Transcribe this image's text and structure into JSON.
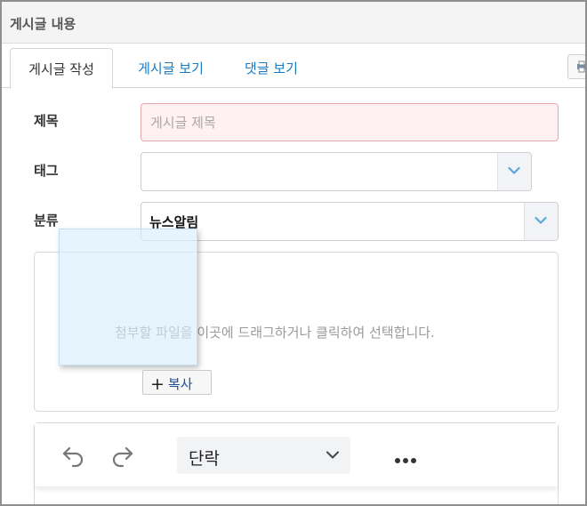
{
  "window": {
    "title": "게시글 내용"
  },
  "tabs": [
    {
      "label": "게시글 작성",
      "active": true
    },
    {
      "label": "게시글 보기",
      "active": false
    },
    {
      "label": "댓글 보기",
      "active": false
    }
  ],
  "form": {
    "title_label": "제목",
    "title_placeholder": "게시글 제목",
    "title_value": "",
    "tag_label": "태그",
    "tag_value": "",
    "category_label": "분류",
    "category_value": "뉴스알림"
  },
  "dropzone": {
    "hint": "첨부할 파일을 이곳에 드래그하거나 클릭하여 선택합니다.",
    "drag_badge": "복사",
    "drag_badge_icon": "plus-icon"
  },
  "editor": {
    "block_type": "단락",
    "icons": [
      "undo-icon",
      "redo-icon",
      "chevron-down-icon",
      "more-icon"
    ]
  },
  "colors": {
    "accent": "#1a7cc4",
    "invalid_bg": "#fff1f1",
    "invalid_border": "#e8a7ab",
    "select_arrow": "#5aa7d9"
  }
}
